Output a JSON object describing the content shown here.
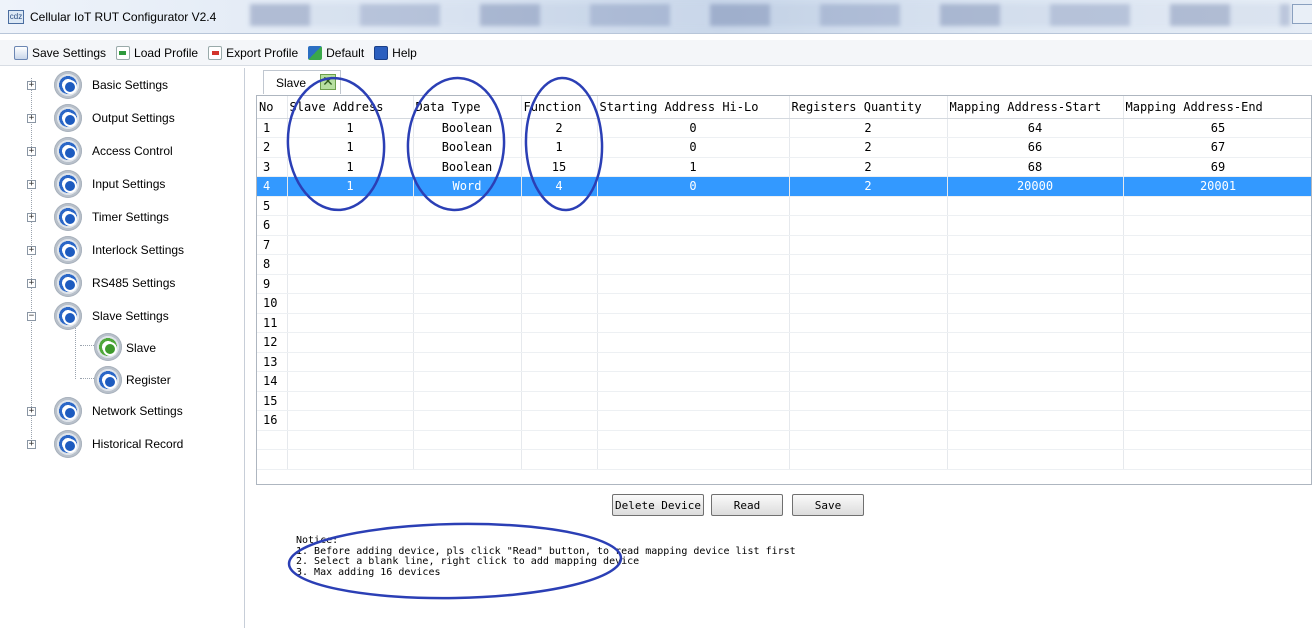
{
  "window": {
    "title": "Cellular IoT RUT Configurator V2.4",
    "icon": "app-icon",
    "icon_text": "cdz"
  },
  "toolbar": {
    "items": [
      {
        "label": "Save Settings",
        "icon": "save-icon"
      },
      {
        "label": "Load Profile",
        "icon": "load-icon"
      },
      {
        "label": "Export Profile",
        "icon": "export-icon"
      },
      {
        "label": "Default",
        "icon": "default-icon"
      },
      {
        "label": "Help",
        "icon": "help-icon"
      }
    ]
  },
  "sidebar": {
    "items": [
      {
        "label": "Basic Settings",
        "expander": "+"
      },
      {
        "label": "Output Settings",
        "expander": "+"
      },
      {
        "label": "Access Control",
        "expander": "+"
      },
      {
        "label": "Input Settings",
        "expander": "+"
      },
      {
        "label": "Timer Settings",
        "expander": "+"
      },
      {
        "label": "Interlock Settings",
        "expander": "+"
      },
      {
        "label": "RS485 Settings",
        "expander": "+"
      },
      {
        "label": "Slave Settings",
        "expander": "−"
      },
      {
        "label": "Network Settings",
        "expander": "+"
      },
      {
        "label": "Historical Record",
        "expander": "+"
      }
    ],
    "children": [
      {
        "label": "Slave",
        "icon": "gear-green-icon"
      },
      {
        "label": "Register",
        "icon": "gear-icon"
      }
    ]
  },
  "tab": {
    "label": "Slave",
    "close_icon": "close-icon",
    "close_glyph": "✕"
  },
  "grid": {
    "headers": [
      "No",
      "Slave Address",
      "Data Type",
      "Function",
      "Starting Address Hi-Lo",
      "Registers Quantity",
      "Mapping Address-Start",
      "Mapping Address-End"
    ],
    "rows": [
      [
        "1",
        "1",
        "Boolean",
        "2",
        "0",
        "2",
        "64",
        "65"
      ],
      [
        "2",
        "1",
        "Boolean",
        "1",
        "0",
        "2",
        "66",
        "67"
      ],
      [
        "3",
        "1",
        "Boolean",
        "15",
        "1",
        "2",
        "68",
        "69"
      ],
      [
        "4",
        "1",
        "Word",
        "4",
        "0",
        "2",
        "20000",
        "20001"
      ],
      [
        "5",
        "",
        "",
        "",
        "",
        "",
        "",
        ""
      ],
      [
        "6",
        "",
        "",
        "",
        "",
        "",
        "",
        ""
      ],
      [
        "7",
        "",
        "",
        "",
        "",
        "",
        "",
        ""
      ],
      [
        "8",
        "",
        "",
        "",
        "",
        "",
        "",
        ""
      ],
      [
        "9",
        "",
        "",
        "",
        "",
        "",
        "",
        ""
      ],
      [
        "10",
        "",
        "",
        "",
        "",
        "",
        "",
        ""
      ],
      [
        "11",
        "",
        "",
        "",
        "",
        "",
        "",
        ""
      ],
      [
        "12",
        "",
        "",
        "",
        "",
        "",
        "",
        ""
      ],
      [
        "13",
        "",
        "",
        "",
        "",
        "",
        "",
        ""
      ],
      [
        "14",
        "",
        "",
        "",
        "",
        "",
        "",
        ""
      ],
      [
        "15",
        "",
        "",
        "",
        "",
        "",
        "",
        ""
      ],
      [
        "16",
        "",
        "",
        "",
        "",
        "",
        "",
        ""
      ],
      [
        "",
        "",
        "",
        "",
        "",
        "",
        "",
        ""
      ],
      [
        "",
        "",
        "",
        "",
        "",
        "",
        "",
        ""
      ]
    ],
    "selected_row": 3,
    "selection_color": "#3399ff"
  },
  "buttons": {
    "delete": "Delete Device",
    "read": "Read",
    "save": "Save"
  },
  "notice": {
    "title": "Notice:",
    "lines": [
      "1. Before adding device, pls click \"Read\" button, to read mapping device list first",
      "2. Select a blank line, right click to add mapping device",
      "3. Max adding 16 devices"
    ]
  },
  "colors": {
    "annotation": "#2b3fb5",
    "accent": "#3399ff"
  }
}
